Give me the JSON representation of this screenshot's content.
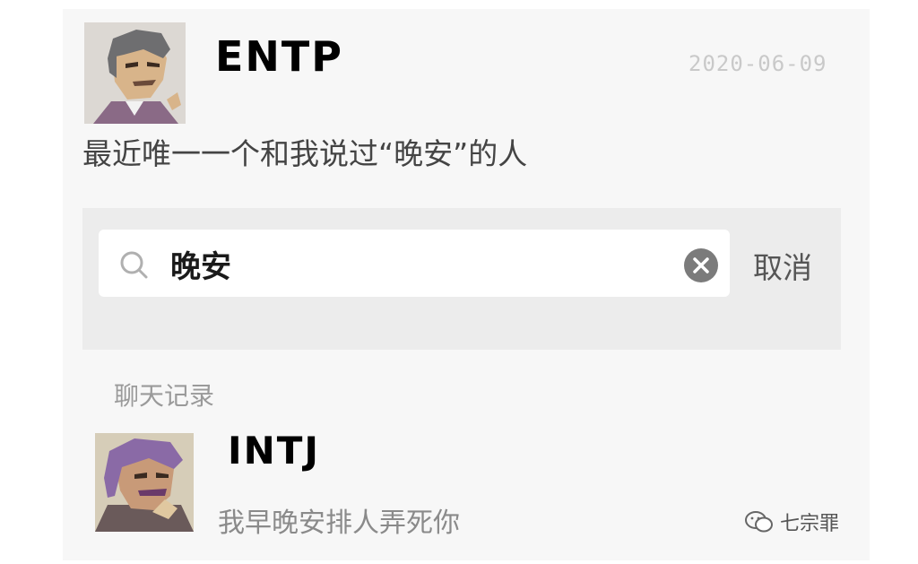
{
  "chat": {
    "sender_name": "ENTP",
    "date": "2020-06-09",
    "message": "最近唯一一个和我说过“晚安”的人"
  },
  "search": {
    "query": "晚安",
    "cancel_label": "取消"
  },
  "results": {
    "section_label": "聊天记录",
    "items": [
      {
        "name": "INTJ",
        "preview": "我早晚安排人弄死你"
      }
    ]
  },
  "watermark": {
    "text": "七宗罪"
  },
  "icons": {
    "search": "search-icon",
    "clear": "clear-icon",
    "watermark": "wechat-icon"
  }
}
